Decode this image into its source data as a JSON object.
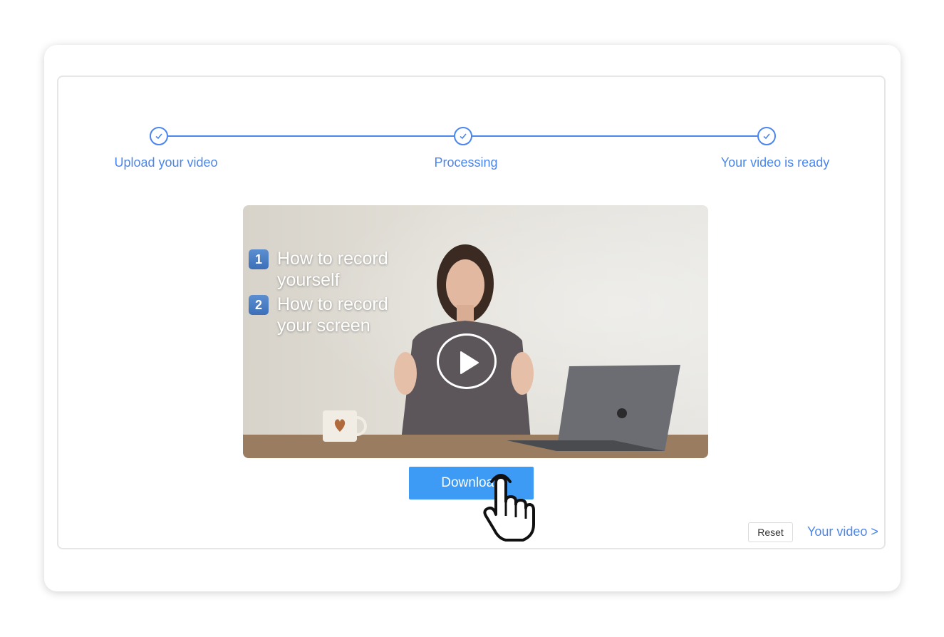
{
  "stepper": {
    "steps": [
      {
        "label": "Upload your video"
      },
      {
        "label": "Processing"
      },
      {
        "label": "Your video is ready"
      }
    ],
    "accent_color": "#4a86ee"
  },
  "video": {
    "overlay": [
      {
        "number": "1",
        "text": "How to record yourself"
      },
      {
        "number": "2",
        "text": "How to record your screen"
      }
    ],
    "play_icon": "play-icon"
  },
  "actions": {
    "download_label": "Download",
    "reset_label": "Reset",
    "your_video_link": "Your video >"
  }
}
